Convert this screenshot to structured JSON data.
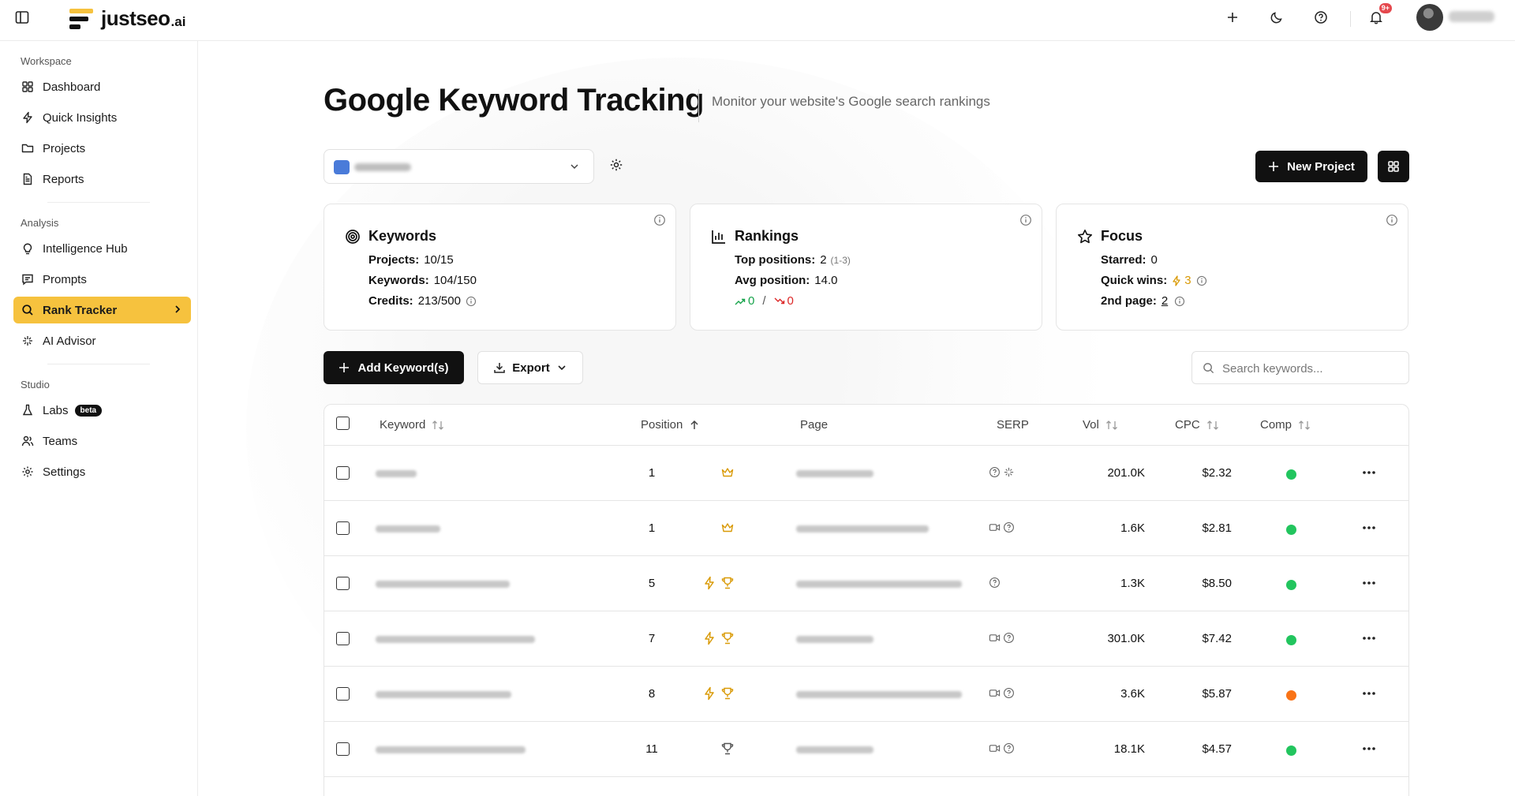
{
  "app": {
    "logo_text": "justseo",
    "logo_suffix": ".ai",
    "notification_badge": "9+"
  },
  "colors": {
    "accent": "#f6c23e",
    "dark": "#111111",
    "up": "#16a34a",
    "down": "#dc2626",
    "comp_green": "#22c55e",
    "comp_orange": "#f97316"
  },
  "sidebar": {
    "sections": [
      {
        "title": "Workspace",
        "items": [
          {
            "label": "Dashboard",
            "icon": "grid-icon"
          },
          {
            "label": "Quick Insights",
            "icon": "zap-icon"
          },
          {
            "label": "Projects",
            "icon": "folder-icon"
          },
          {
            "label": "Reports",
            "icon": "file-icon"
          }
        ]
      },
      {
        "title": "Analysis",
        "items": [
          {
            "label": "Intelligence Hub",
            "icon": "lightbulb-icon"
          },
          {
            "label": "Prompts",
            "icon": "message-icon"
          },
          {
            "label": "Rank Tracker",
            "icon": "search-icon",
            "active": true
          },
          {
            "label": "AI Advisor",
            "icon": "sparkles-icon"
          }
        ]
      },
      {
        "title": "Studio",
        "items": [
          {
            "label": "Labs",
            "icon": "flask-icon",
            "badge": "beta"
          },
          {
            "label": "Teams",
            "icon": "users-icon"
          },
          {
            "label": "Settings",
            "icon": "gear-icon"
          }
        ]
      }
    ]
  },
  "page": {
    "title": "Google Keyword Tracking",
    "subtitle": "Monitor your website's Google search rankings",
    "new_project_label": "New Project"
  },
  "cards": {
    "keywords": {
      "title": "Keywords",
      "projects_label": "Projects:",
      "projects_value": "10/15",
      "keywords_label": "Keywords:",
      "keywords_value": "104/150",
      "credits_label": "Credits:",
      "credits_value": "213/500"
    },
    "rankings": {
      "title": "Rankings",
      "top_label": "Top positions:",
      "top_value": "2",
      "top_range": "(1-3)",
      "avg_label": "Avg position:",
      "avg_value": "14.0",
      "up_value": "0",
      "separator": "/",
      "down_value": "0"
    },
    "focus": {
      "title": "Focus",
      "starred_label": "Starred:",
      "starred_value": "0",
      "quickwins_label": "Quick wins:",
      "quickwins_value": "3",
      "secondpage_label": "2nd page:",
      "secondpage_value": "2"
    }
  },
  "toolbar": {
    "add_label": "Add Keyword(s)",
    "export_label": "Export",
    "search_placeholder": "Search keywords..."
  },
  "table": {
    "headers": {
      "keyword": "Keyword",
      "position": "Position",
      "page": "Page",
      "serp": "SERP",
      "vol": "Vol",
      "cpc": "CPC",
      "comp": "Comp"
    },
    "rows": [
      {
        "position": "1",
        "badge": "crown",
        "vol": "201.0K",
        "cpc": "$2.32",
        "comp": "green",
        "serp": [
          "help-icon",
          "sparkle-icon"
        ]
      },
      {
        "position": "1",
        "badge": "crown",
        "vol": "1.6K",
        "cpc": "$2.81",
        "comp": "green",
        "serp": [
          "video-icon",
          "help-icon"
        ]
      },
      {
        "position": "5",
        "badge": "quick-trophy",
        "vol": "1.3K",
        "cpc": "$8.50",
        "comp": "green",
        "serp": [
          "help-icon"
        ]
      },
      {
        "position": "7",
        "badge": "quick-trophy",
        "vol": "301.0K",
        "cpc": "$7.42",
        "comp": "green",
        "serp": [
          "video-icon",
          "help-icon"
        ]
      },
      {
        "position": "8",
        "badge": "quick-trophy",
        "vol": "3.6K",
        "cpc": "$5.87",
        "comp": "orange",
        "serp": [
          "video-icon",
          "help-icon"
        ]
      },
      {
        "position": "11",
        "badge": "trophy-outline",
        "vol": "18.1K",
        "cpc": "$4.57",
        "comp": "green",
        "serp": [
          "video-icon",
          "help-icon"
        ]
      }
    ]
  }
}
